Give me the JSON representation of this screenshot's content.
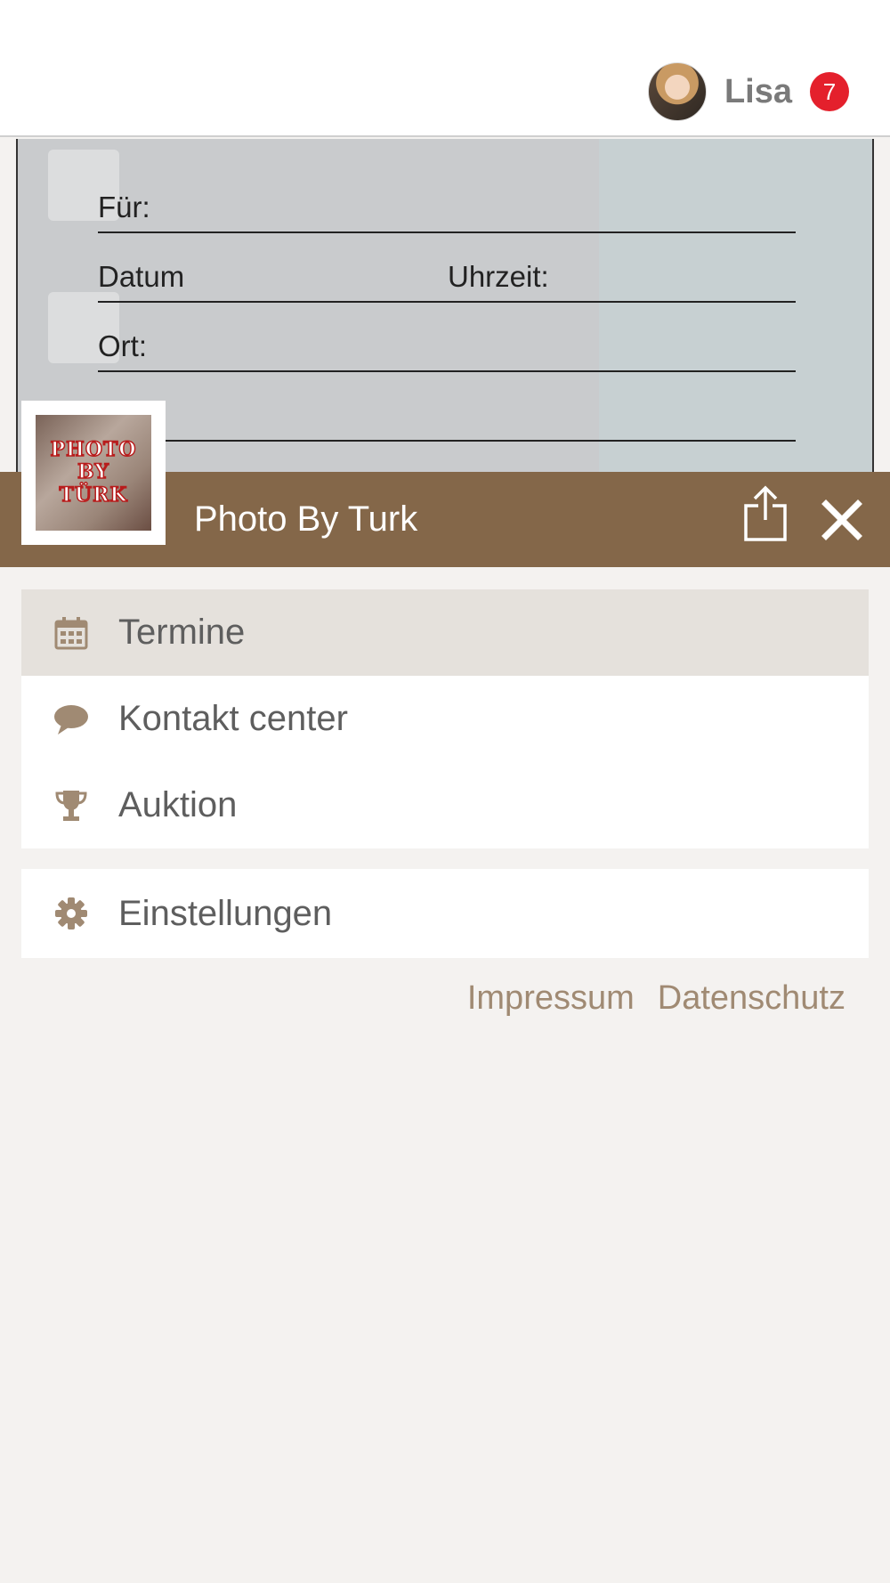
{
  "header": {
    "user_name": "Lisa",
    "notification_count": "7"
  },
  "background_form": {
    "fields": [
      "Für:",
      "Datum",
      "Uhrzeit:",
      "Ort:"
    ]
  },
  "brand": {
    "logo_lines": [
      "PHOTO",
      "BY",
      "TÜRK"
    ],
    "title": "Photo By Turk",
    "color": "#846749"
  },
  "menu": {
    "main_items": [
      {
        "label": "Termine",
        "icon": "calendar-icon",
        "active": true
      },
      {
        "label": "Kontakt center",
        "icon": "speech-bubble-icon",
        "active": false
      },
      {
        "label": "Auktion",
        "icon": "trophy-icon",
        "active": false
      }
    ],
    "settings_item": {
      "label": "Einstellungen",
      "icon": "gear-icon"
    }
  },
  "footer": {
    "impressum": "Impressum",
    "datenschutz": "Datenschutz"
  },
  "colors": {
    "accent_brown": "#846749",
    "icon_tan": "#a08a73",
    "badge_red": "#e4202c",
    "active_row": "#e5e1dc"
  }
}
